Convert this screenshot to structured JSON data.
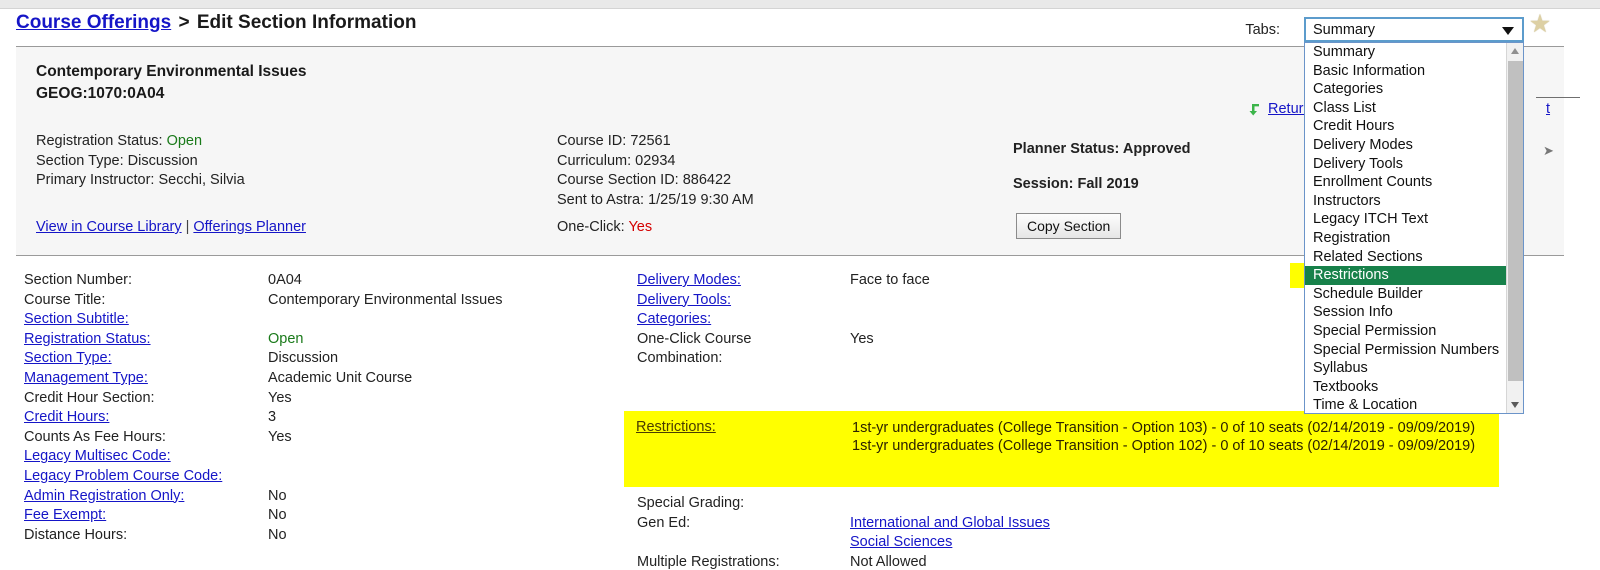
{
  "breadcrumb": {
    "link": "Course Offerings",
    "separator": ">",
    "current": "Edit Section Information"
  },
  "tabs_selector": {
    "label": "Tabs:",
    "selected": "Summary",
    "star_icon": "star-icon",
    "arrow_icon": "chevron-down-icon",
    "options": [
      "Summary",
      "Basic Information",
      "Categories",
      "Class List",
      "Credit Hours",
      "Delivery Modes",
      "Delivery Tools",
      "Enrollment Counts",
      "Instructors",
      "Legacy ITCH Text",
      "Registration",
      "Related Sections",
      "Restrictions",
      "Schedule Builder",
      "Session Info",
      "Special Permission",
      "Special Permission Numbers",
      "Syllabus",
      "Textbooks",
      "Time & Location"
    ],
    "highlighted_option": "Restrictions",
    "highlight_bg": "#17814a",
    "annotation_color": "#ffff00"
  },
  "info_panel": {
    "course_name": "Contemporary Environmental Issues",
    "course_code": "GEOG:1070:0A04",
    "left_meta": [
      {
        "label": "Registration Status:",
        "value": "Open",
        "value_color": "#1a7a1a"
      },
      {
        "label": "Section Type:",
        "value": "Discussion",
        "value_color": ""
      },
      {
        "label": "Primary Instructor:",
        "value": "Secchi, Silvia",
        "value_color": ""
      }
    ],
    "mid_meta": [
      {
        "label": "Course ID:",
        "value": "72561"
      },
      {
        "label": "Curriculum:",
        "value": "02934"
      },
      {
        "label": "Course Section ID:",
        "value": "886422"
      },
      {
        "label": "Sent to Astra:",
        "value": "1/25/19 9:30 AM"
      }
    ],
    "right_meta": [
      {
        "label": "Planner Status:",
        "value": "Approved"
      },
      {
        "label": "Session:",
        "value": "Fall 2019"
      }
    ],
    "links": [
      "View in Course Library",
      "Offerings Planner"
    ],
    "link_separator": "|",
    "one_click": {
      "label": "One-Click:",
      "value": "Yes",
      "value_color": "#d40000"
    },
    "copy_button": "Copy Section",
    "return_link": "Return",
    "return_icon": "return-arrow-icon",
    "right_stub": "t"
  },
  "detail_left": [
    {
      "label": "Section Number:",
      "link": false,
      "value": "0A04"
    },
    {
      "label": "Course Title:",
      "link": false,
      "value": "Contemporary Environmental Issues"
    },
    {
      "label": "Section Subtitle:",
      "link": true,
      "value": ""
    },
    {
      "label": "Registration Status:",
      "link": true,
      "value": "Open",
      "value_color": "#1a7a1a"
    },
    {
      "label": "Section Type:",
      "link": true,
      "value": "Discussion"
    },
    {
      "label": "Management Type:",
      "link": true,
      "value": "Academic Unit Course"
    },
    {
      "label": "Credit Hour Section:",
      "link": false,
      "value": "Yes"
    },
    {
      "label": "Credit Hours:",
      "link": true,
      "value": "3"
    },
    {
      "label": "Counts As Fee Hours:",
      "link": false,
      "value": "Yes"
    },
    {
      "label": "Legacy Multisec Code:",
      "link": true,
      "value": ""
    },
    {
      "label": "Legacy Problem Course Code:",
      "link": true,
      "value": ""
    },
    {
      "label": "Admin Registration Only:",
      "link": true,
      "value": "No"
    },
    {
      "label": "Fee Exempt:",
      "link": true,
      "value": "No"
    },
    {
      "label": "Distance Hours:",
      "link": false,
      "value": "No"
    }
  ],
  "detail_right_top": [
    {
      "label": "Delivery Modes:",
      "link": true,
      "value": "Face to face"
    },
    {
      "label": "Delivery Tools:",
      "link": true,
      "value": ""
    },
    {
      "label": "Categories:",
      "link": true,
      "value": ""
    },
    {
      "label": "One-Click Course",
      "label2": "Combination:",
      "link": false,
      "value": "Yes"
    }
  ],
  "restrictions": {
    "label": "Restrictions:",
    "lines": [
      "1st-yr undergraduates (College Transition - Option 103) - 0 of 10 seats  (02/14/2019 - 09/09/2019)",
      "1st-yr undergraduates (College Transition - Option 102) - 0 of 10 seats  (02/14/2019 - 09/09/2019)"
    ]
  },
  "detail_right_bottom": [
    {
      "label": "Special Grading:",
      "value": ""
    },
    {
      "label": "Gen Ed:",
      "values": [
        "International and Global Issues",
        "Social Sciences"
      ],
      "link_values": true
    },
    {
      "label": "Multiple Registrations:",
      "value": "Not Allowed"
    }
  ]
}
